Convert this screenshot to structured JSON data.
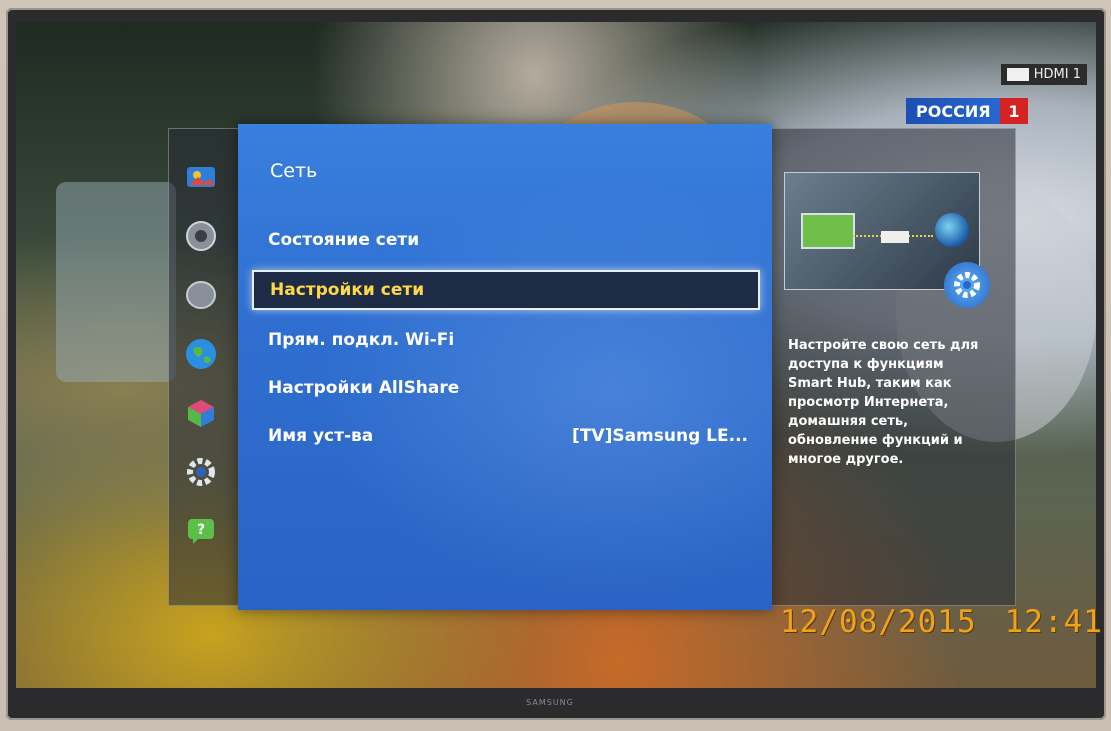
{
  "source_badge": {
    "label": "HDMI 1"
  },
  "channel_logo": {
    "name": "РОССИЯ",
    "number": "1"
  },
  "sidebar": {
    "items": [
      {
        "icon": "picture-icon",
        "color": "#2f7fd9"
      },
      {
        "icon": "sound-icon",
        "color": "#8a9099"
      },
      {
        "icon": "broadcast-icon",
        "color": "#8a9099"
      },
      {
        "icon": "network-globe-icon",
        "color": "#2a8fe0"
      },
      {
        "icon": "smart-hub-cube-icon",
        "color": "#54b947"
      },
      {
        "icon": "settings-gear-icon",
        "color": "#e0e6ee"
      },
      {
        "icon": "support-help-icon",
        "color": "#5ac04a"
      }
    ]
  },
  "menu": {
    "title": "Сеть",
    "items": [
      {
        "label": "Состояние сети",
        "value": "",
        "selected": false
      },
      {
        "label": "Настройки сети",
        "value": "",
        "selected": true
      },
      {
        "label": "Прям. подкл. Wi-Fi",
        "value": "",
        "selected": false
      },
      {
        "label": "Настройки AllShare",
        "value": "",
        "selected": false
      },
      {
        "label": "Имя уст-ва",
        "value": "[TV]Samsung LE...",
        "selected": false
      }
    ]
  },
  "help": {
    "text": "Настройте свою сеть для доступа к функциям Smart Hub, таким как просмотр Интернета, домашняя сеть, обновление функций и многое другое."
  },
  "timestamp": {
    "date": "12/08/2015",
    "time": "12:41"
  },
  "tv_brand": "SAMSUNG",
  "colors": {
    "menu_blue": "#2f6fd0",
    "highlight_text": "#ffd84a",
    "timestamp_orange": "#f0a21a"
  }
}
